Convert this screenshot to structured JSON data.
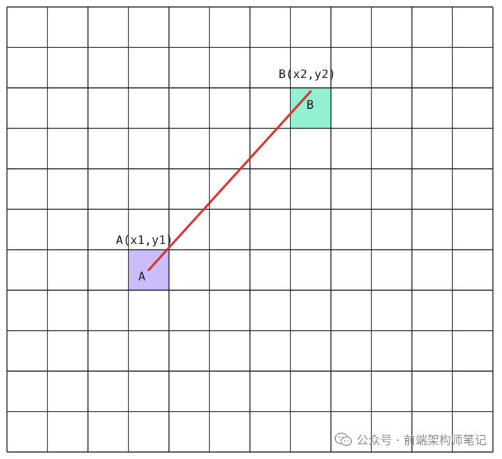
{
  "grid": {
    "rows": 11,
    "cols": 12
  },
  "point_a": {
    "caption": "A(x1,y1)",
    "cell_label": "A",
    "row": 6,
    "col": 3,
    "color": "#cbbdfb"
  },
  "point_b": {
    "caption": "B(x2,y2)",
    "cell_label": "B",
    "row": 2,
    "col": 7,
    "color": "#92f0d3"
  },
  "connector": {
    "color": "#d8302f"
  },
  "watermark": {
    "icon": "wechat-icon",
    "text": "公众号 · 前端架构师笔记"
  }
}
